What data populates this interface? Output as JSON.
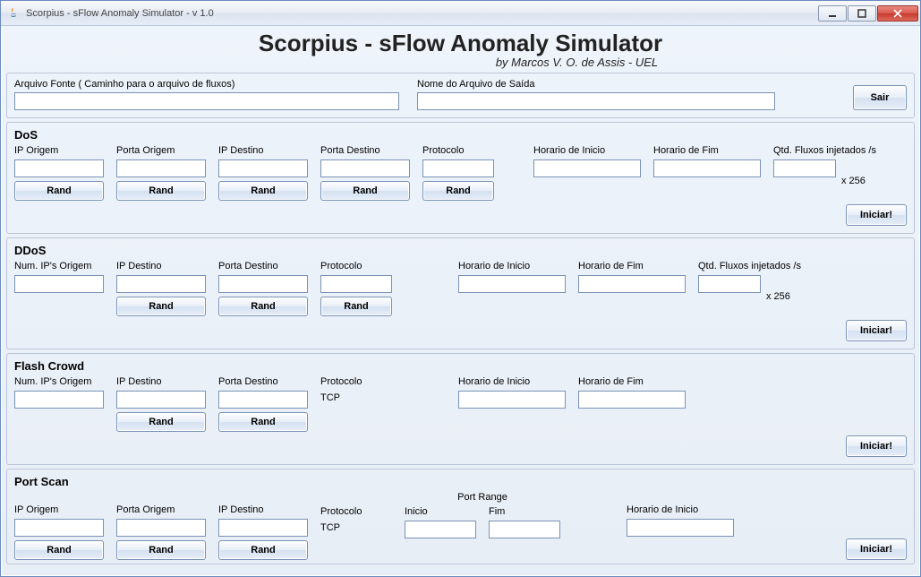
{
  "window": {
    "title": "Scorpius - sFlow Anomaly Simulator - v 1.0"
  },
  "header": {
    "title": "Scorpius - sFlow Anomaly Simulator",
    "subtitle": "by Marcos V. O. de Assis - UEL"
  },
  "top": {
    "src_label": "Arquivo Fonte ( Caminho para o arquivo de fluxos)",
    "src_value": "",
    "out_label": "Nome do Arquivo de Saída",
    "out_value": "",
    "sair": "Sair"
  },
  "common": {
    "rand": "Rand",
    "iniciar": "Iniciar!",
    "x256": "x 256"
  },
  "dos": {
    "title": "DoS",
    "ip_origem": "IP Origem",
    "porta_origem": "Porta Origem",
    "ip_destino": "IP Destino",
    "porta_destino": "Porta Destino",
    "protocolo": "Protocolo",
    "horario_inicio": "Horario de Inicio",
    "horario_fim": "Horario de Fim",
    "qtd_fluxos": "Qtd. Fluxos injetados /s"
  },
  "ddos": {
    "title": "DDoS",
    "num_ips": "Num. IP's Origem",
    "ip_destino": "IP Destino",
    "porta_destino": "Porta Destino",
    "protocolo": "Protocolo",
    "horario_inicio": "Horario de Inicio",
    "horario_fim": "Horario de Fim",
    "qtd_fluxos": "Qtd. Fluxos injetados /s"
  },
  "flash": {
    "title": "Flash Crowd",
    "num_ips": "Num. IP's Origem",
    "ip_destino": "IP Destino",
    "porta_destino": "Porta Destino",
    "protocolo": "Protocolo",
    "protocolo_value": "TCP",
    "horario_inicio": "Horario de Inicio",
    "horario_fim": "Horario de Fim"
  },
  "portscan": {
    "title": "Port Scan",
    "ip_origem": "IP Origem",
    "porta_origem": "Porta Origem",
    "ip_destino": "IP Destino",
    "protocolo": "Protocolo",
    "protocolo_value": "TCP",
    "port_range": "Port Range",
    "inicio": "Inicio",
    "fim": "Fim",
    "horario_inicio": "Horario de Inicio"
  }
}
